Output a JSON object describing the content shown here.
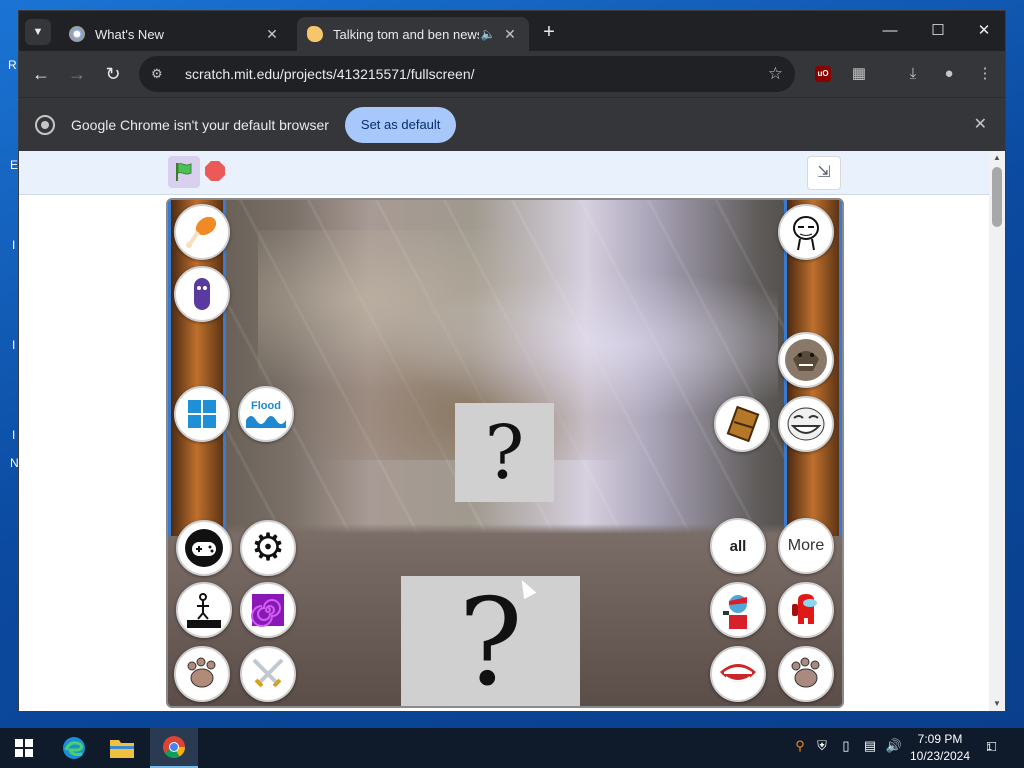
{
  "desktop": {
    "fragments": [
      "R",
      "E",
      "I",
      "I",
      "I",
      "N"
    ]
  },
  "tabs": [
    {
      "title": "What's New",
      "active": false
    },
    {
      "title": "Talking tom and ben news f",
      "active": true
    }
  ],
  "toolbar": {
    "url": "scratch.mit.edu/projects/413215571/fullscreen/",
    "ublock_label": "uO"
  },
  "infobar": {
    "message": "Google Chrome isn't your default browser",
    "button_label": "Set as default"
  },
  "stage": {
    "left_buttons": [
      {
        "name": "chicken-leg",
        "icon": "chicken-leg-icon",
        "label": ""
      },
      {
        "name": "purple-blob",
        "icon": "purple-creature-icon",
        "label": ""
      },
      {
        "name": "windows",
        "icon": "windows-logo-icon",
        "label": ""
      },
      {
        "name": "flood",
        "icon": "flood-icon",
        "label": "Flood"
      },
      {
        "name": "gamepad",
        "icon": "gamepad-icon",
        "label": ""
      },
      {
        "name": "settings",
        "icon": "gear-icon",
        "label": ""
      },
      {
        "name": "stick-figure",
        "icon": "stick-figure-icon",
        "label": ""
      },
      {
        "name": "spiral",
        "icon": "spiral-icon",
        "label": ""
      },
      {
        "name": "paw-left",
        "icon": "paw-icon",
        "label": ""
      },
      {
        "name": "swords",
        "icon": "crossed-swords-icon",
        "label": ""
      }
    ],
    "right_buttons": [
      {
        "name": "meme-face",
        "icon": "meme-face-icon",
        "label": ""
      },
      {
        "name": "trex",
        "icon": "trex-icon",
        "label": ""
      },
      {
        "name": "chocolate",
        "icon": "chocolate-bar-icon",
        "label": ""
      },
      {
        "name": "trollface",
        "icon": "trollface-icon",
        "label": ""
      },
      {
        "name": "all",
        "icon": "",
        "label": "all"
      },
      {
        "name": "more",
        "icon": "",
        "label": "More"
      },
      {
        "name": "fnf",
        "icon": "fnf-character-icon",
        "label": ""
      },
      {
        "name": "among-us",
        "icon": "among-us-icon",
        "label": ""
      },
      {
        "name": "mouth",
        "icon": "mouth-icon",
        "label": ""
      },
      {
        "name": "paw-right",
        "icon": "paw-icon",
        "label": ""
      }
    ],
    "question_small": "?",
    "question_large": "?"
  },
  "taskbar": {
    "time": "7:09 PM",
    "date": "10/23/2024",
    "notification_count": "1"
  },
  "colors": {
    "chrome_dark": "#202124",
    "chrome_toolbar": "#35363a",
    "set_default_bg": "#a8c7fa",
    "scratch_controls_bg": "#e9f1fc",
    "taskbar_bg": "#0f1a2a"
  }
}
